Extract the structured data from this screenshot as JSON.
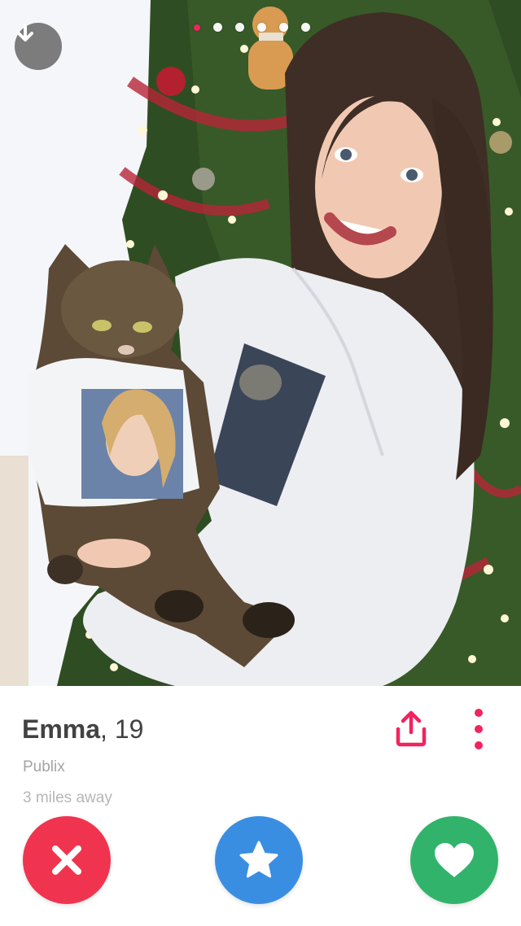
{
  "profile": {
    "name": "Emma",
    "age_text": ", 19",
    "job": "Publix",
    "distance": "3 miles away"
  },
  "photo": {
    "description_alt": "Profile photo",
    "pager": {
      "count": 6,
      "active_index": 0
    }
  },
  "icons": {
    "collapse": "arrow-down-icon",
    "share": "share-icon",
    "more": "more-vertical-icon",
    "nope": "x-icon",
    "super_like": "star-icon",
    "like": "heart-icon"
  },
  "colors": {
    "brand_pink": "#f2235e",
    "nope": "#f0344f",
    "super_like": "#3a8ee2",
    "like": "#32b36b"
  }
}
